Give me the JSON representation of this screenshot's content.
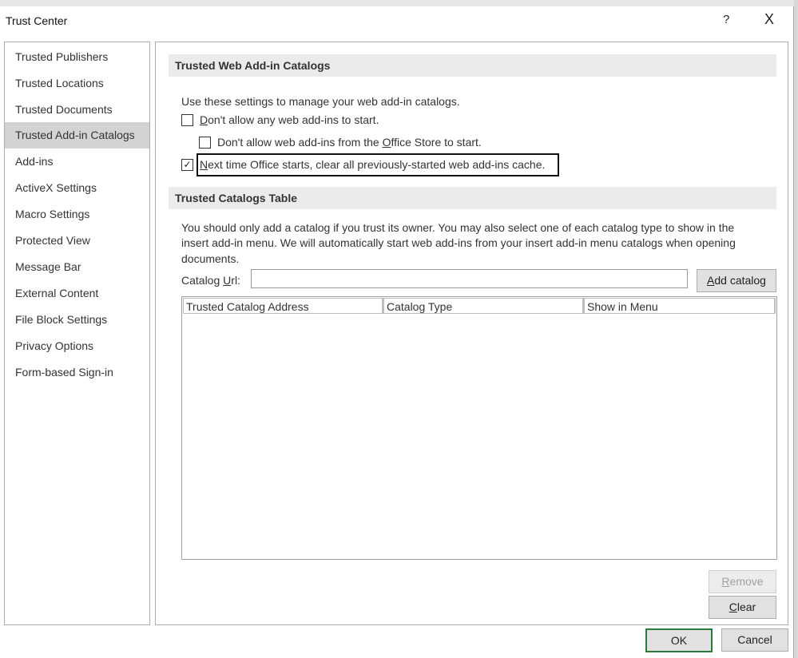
{
  "window": {
    "title": "Trust Center",
    "help_icon": "?",
    "close_icon": "X"
  },
  "sidebar": {
    "items": [
      {
        "label": "Trusted Publishers"
      },
      {
        "label": "Trusted Locations"
      },
      {
        "label": "Trusted Documents"
      },
      {
        "label": "Trusted Add-in Catalogs",
        "selected": true
      },
      {
        "label": "Add-ins"
      },
      {
        "label": "ActiveX Settings"
      },
      {
        "label": "Macro Settings"
      },
      {
        "label": "Protected View"
      },
      {
        "label": "Message Bar"
      },
      {
        "label": "External Content"
      },
      {
        "label": "File Block Settings"
      },
      {
        "label": "Privacy Options"
      },
      {
        "label": "Form-based Sign-in"
      }
    ]
  },
  "web_addins": {
    "heading": "Trusted Web Add-in Catalogs",
    "intro": "Use these settings to manage your web add-in catalogs.",
    "opt1": {
      "key": "D",
      "rest": "on't allow any web add-ins to start.",
      "checked": false
    },
    "opt2": {
      "pre": "Don't allow web add-ins from the ",
      "key": "O",
      "rest": "ffice Store to start.",
      "checked": false
    },
    "opt3": {
      "key": "N",
      "rest": "ext time Office starts, clear all previously-started web add-ins cache.",
      "checked": true
    }
  },
  "catalogs": {
    "heading": "Trusted Catalogs Table",
    "desc_line1": "You should only add a catalog if you trust its owner. You may also select one of each catalog type to show in the",
    "desc_line2": "insert add-in menu. We will automatically start web add-ins from your insert add-in menu catalogs when opening",
    "desc_line3": "documents.",
    "url_label": {
      "pre": "Catalog ",
      "key": "U",
      "rest": "rl:"
    },
    "url_value": "",
    "add_button": {
      "key": "A",
      "rest": "dd catalog"
    },
    "columns": [
      "Trusted Catalog Address",
      "Catalog Type",
      "Show in Menu"
    ],
    "rows": [],
    "remove_button": {
      "key": "R",
      "rest": "emove",
      "enabled": false
    },
    "clear_button": {
      "key": "C",
      "rest": "lear"
    }
  },
  "footer": {
    "ok": "OK",
    "cancel": "Cancel"
  }
}
